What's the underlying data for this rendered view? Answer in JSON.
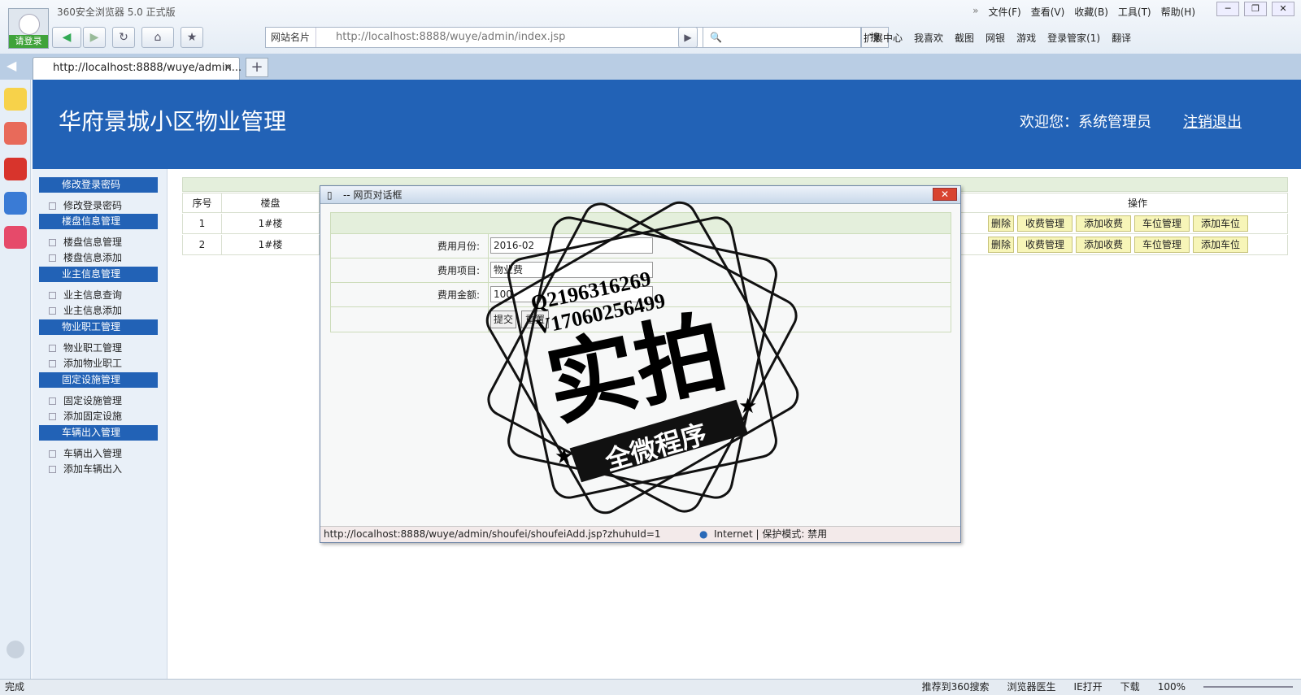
{
  "browser": {
    "avatar_label": "请登录",
    "app_title": "360安全浏览器 5.0 正式版",
    "menu": [
      "文件(F)",
      "查看(V)",
      "收藏(B)",
      "工具(T)",
      "帮助(H)"
    ],
    "site_card": "网站名片",
    "address": "http://localhost:8888/wuye/admin/index.jsp",
    "search_button": "搜",
    "toolbar": [
      "扩展中心",
      "我喜欢",
      "截图",
      "网银",
      "游戏",
      "登录管家(1)",
      "翻译"
    ],
    "tab_title": "http://localhost:8888/wuye/admin...",
    "tab_close": "×",
    "tab_add": "+"
  },
  "header": {
    "title": "华府景城小区物业管理",
    "welcome": "欢迎您：系统管理员",
    "logout": "注销退出"
  },
  "nav": [
    {
      "head": "修改登录密码",
      "items": [
        "修改登录密码"
      ]
    },
    {
      "head": "楼盘信息管理",
      "items": [
        "楼盘信息管理",
        "楼盘信息添加"
      ]
    },
    {
      "head": "业主信息管理",
      "items": [
        "业主信息查询",
        "业主信息添加"
      ]
    },
    {
      "head": "物业职工管理",
      "items": [
        "物业职工管理",
        "添加物业职工"
      ]
    },
    {
      "head": "固定设施管理",
      "items": [
        "固定设施管理",
        "添加固定设施"
      ]
    },
    {
      "head": "车辆出入管理",
      "items": [
        "车辆出入管理",
        "添加车辆出入"
      ]
    }
  ],
  "table": {
    "headers": {
      "no": "序号",
      "building": "楼盘",
      "ops": "操作"
    },
    "rows": [
      {
        "no": "1",
        "building": "1#楼"
      },
      {
        "no": "2",
        "building": "1#楼"
      }
    ],
    "ops": [
      "删除",
      "收费管理",
      "添加收费",
      "车位管理",
      "添加车位"
    ]
  },
  "dialog": {
    "title": "-- 网页对话框",
    "close": "✕",
    "fields": [
      {
        "label": "费用月份:",
        "value": "2016-02"
      },
      {
        "label": "费用项目:",
        "value": "物业费"
      },
      {
        "label": "费用金额:",
        "value": "100"
      }
    ],
    "submit": "提交",
    "reset": "重置",
    "status_url": "http://localhost:8888/wuye/admin/shoufei/shoufeiAdd.jsp?zhuhuId=1",
    "status_zone": "Internet | 保护模式: 禁用"
  },
  "watermark": {
    "line1": "Q2196316269",
    "line2": "V17060256499",
    "big": "实拍",
    "ribbon": "全微程序"
  },
  "statusbar": {
    "left": "完成",
    "right": [
      "推荐到360搜索",
      "浏览器医生",
      "IE打开",
      "下载",
      "100%"
    ]
  }
}
